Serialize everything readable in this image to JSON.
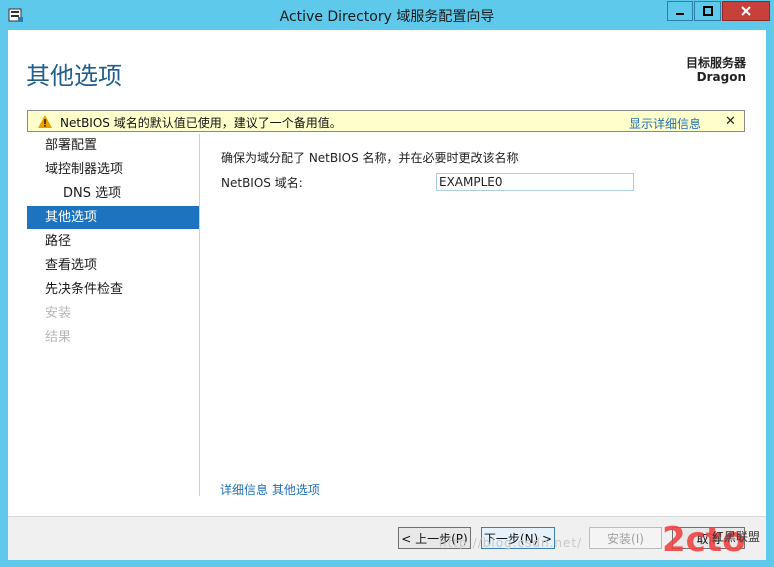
{
  "window": {
    "title": "Active Directory 域服务配置向导",
    "icon": "server-manager-icon"
  },
  "header": {
    "page_title": "其他选项",
    "target_label": "目标服务器",
    "target_name": "Dragon"
  },
  "warning": {
    "text": "NetBIOS 域名的默认值已使用，建议了一个备用值。",
    "details_link": "显示详细信息",
    "close_glyph": "✕"
  },
  "nav": {
    "items": [
      {
        "label": "部署配置",
        "state": "normal"
      },
      {
        "label": "域控制器选项",
        "state": "normal"
      },
      {
        "label": "DNS 选项",
        "state": "sub"
      },
      {
        "label": "其他选项",
        "state": "active"
      },
      {
        "label": "路径",
        "state": "normal"
      },
      {
        "label": "查看选项",
        "state": "normal"
      },
      {
        "label": "先决条件检查",
        "state": "normal"
      },
      {
        "label": "安装",
        "state": "disabled"
      },
      {
        "label": "结果",
        "state": "disabled"
      }
    ]
  },
  "content": {
    "description": "确保为域分配了 NetBIOS 名称，并在必要时更改该名称",
    "netbios_label": "NetBIOS 域名:",
    "netbios_value": "EXAMPLE0",
    "more_link": "详细信息 其他选项"
  },
  "footer": {
    "prev_label": "< 上一步(P)",
    "next_label": "下一步(N) >",
    "install_label": "安装(I)",
    "cancel_label": "取消"
  },
  "watermark": {
    "url": "http://blog.csdn.net/",
    "logo": "2cto",
    "brand": "红黑联盟"
  },
  "colors": {
    "title_bar": "#5fc9ec",
    "accent": "#1e73be",
    "warning_bg": "#ffffcc",
    "close_button": "#c7403a",
    "link": "#1f6fb5"
  }
}
